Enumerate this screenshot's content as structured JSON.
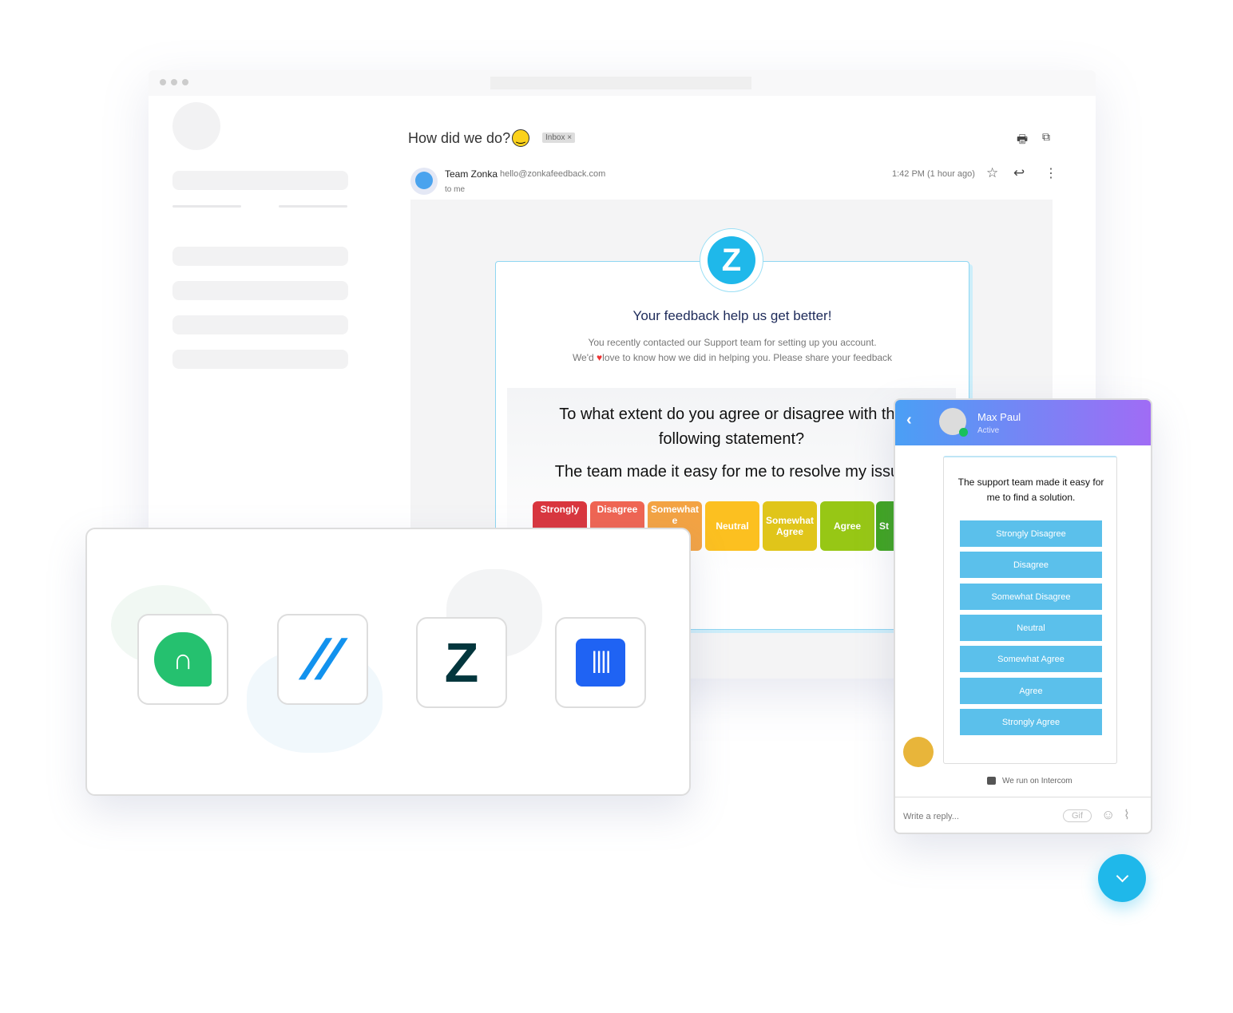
{
  "email": {
    "subject": "How did we do?",
    "label_tag": "Inbox ×",
    "sender_name": "Team Zonka",
    "sender_email": "hello@zonkafeedback.com",
    "to": "to me",
    "time": "1:42 PM (1 hour ago)",
    "icons": [
      "print-icon",
      "open-external-icon",
      "star-icon",
      "reply-icon",
      "more-vertical-icon"
    ]
  },
  "survey": {
    "heading": "Your feedback help us get better!",
    "intro1": "You recently contacted our Support team for setting up you account.",
    "intro2_a": "We'd",
    "intro2_b": "love to know how we did in helping you. Please share your feedback",
    "question": "To what extent do you agree or disagree with the following statement?",
    "statement": "The team made it easy for me to resolve my issue",
    "scale": [
      {
        "label": "Strongly",
        "color": "#d9363e"
      },
      {
        "label": "Disagree",
        "color": "#ef6553"
      },
      {
        "label": "Somewhat e",
        "color": "#f3a343"
      },
      {
        "label": "Neutral",
        "color": "#fcc020"
      },
      {
        "label": "Somewhat Agree",
        "color": "#e0c51a"
      },
      {
        "label": "Agree",
        "color": "#97c715"
      },
      {
        "label": "St A",
        "color": "#3ea41f"
      }
    ]
  },
  "integrations": [
    "freshdesk",
    "helpscout",
    "zendesk",
    "intercom"
  ],
  "chat": {
    "name": "Max Paul",
    "status": "Active",
    "prompt": "The support team made it easy for me to find a solution.",
    "options": [
      "Strongly Disagree",
      "Disagree",
      "Somewhat Disagree",
      "Neutral",
      "Somewhat Agree",
      "Agree",
      "Strongly Agree"
    ],
    "powered": "We run on Intercom",
    "reply_placeholder": "Write a reply...",
    "gif": "Gif"
  }
}
